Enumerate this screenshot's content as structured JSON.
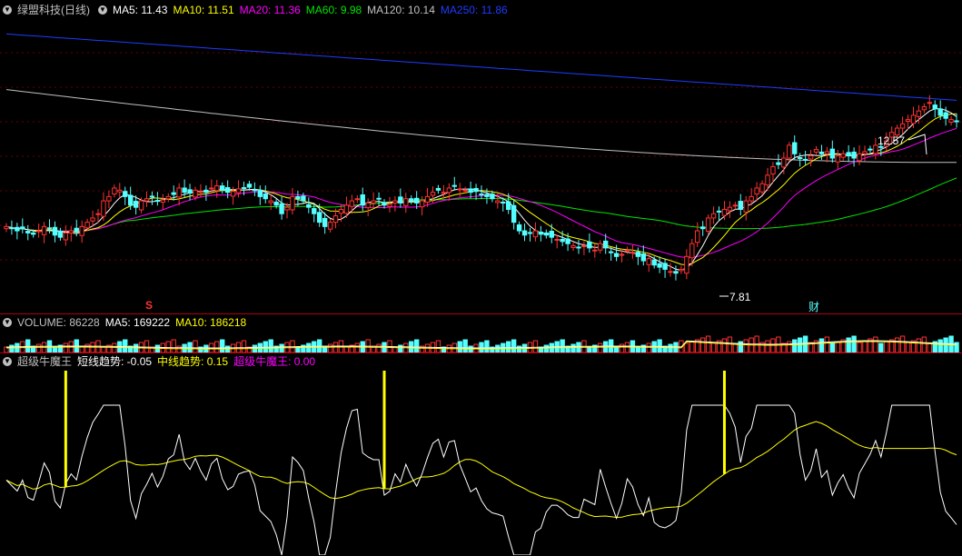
{
  "colors": {
    "red": "#ff3232",
    "cyan": "#54ffff",
    "white": "#ffffff",
    "yellow": "#ffff00",
    "magenta": "#ff00ff",
    "green": "#00e600",
    "gray": "#c0c0c0",
    "blue": "#1e3cff"
  },
  "main_legend": {
    "icon": "collapse-circle-icon",
    "title": "绿盟科技(日线)",
    "ma5": "MA5: 11.43",
    "ma10": "MA10: 11.51",
    "ma20": "MA20: 11.36",
    "ma60": "MA60: 9.98",
    "ma120": "MA120: 10.14",
    "ma250": "MA250: 11.86"
  },
  "volume_legend": {
    "icon": "collapse-circle-icon",
    "volume": "VOLUME: 86228",
    "ma5": "MA5: 169222",
    "ma10": "MA10: 186218"
  },
  "indicator_legend": {
    "icon": "collapse-circle-icon",
    "name": "超级牛魔王",
    "short_trend": "短线趋势: -0.05",
    "mid_trend": "中线趋势: 0.15",
    "niu": "超级牛魔王: 0.00"
  },
  "annotations": {
    "high_label": "12.57",
    "low_label": "7.81",
    "marker_s": "S",
    "marker_cai": "财"
  },
  "chart_data": [
    {
      "type": "candlestick",
      "title": "绿盟科技(日线)",
      "ylim": [
        7.4,
        13.6
      ],
      "x": [
        0,
        1,
        2,
        3,
        4,
        5,
        6,
        7,
        8,
        9,
        10,
        11,
        12,
        13,
        14,
        15,
        16,
        17,
        18,
        19,
        20,
        21,
        22,
        23,
        24,
        25,
        26,
        27,
        28,
        29,
        30,
        31,
        32,
        33,
        34,
        35,
        36,
        37,
        38,
        39,
        40,
        41,
        42,
        43,
        44,
        45,
        46,
        47,
        48,
        49,
        50,
        51,
        52,
        53,
        54,
        55,
        56,
        57,
        58,
        59,
        60,
        61,
        62,
        63,
        64,
        65,
        66,
        67,
        68,
        69,
        70,
        71,
        72,
        73,
        74,
        75,
        76,
        77,
        78,
        79,
        80,
        81,
        82,
        83,
        84,
        85,
        86,
        87,
        88,
        89,
        90,
        91,
        92,
        93,
        94,
        95,
        96,
        97,
        98,
        99,
        100,
        101,
        102,
        103,
        104,
        105,
        106,
        107,
        108,
        109,
        110,
        111,
        112,
        113,
        114,
        115,
        116,
        117,
        118,
        119,
        120,
        121,
        122,
        123,
        124,
        125,
        126,
        127,
        128,
        129,
        130,
        131,
        132,
        133,
        134,
        135,
        136,
        137,
        138,
        139,
        140,
        141,
        142,
        143,
        144,
        145,
        146,
        147,
        148,
        149,
        150,
        151,
        152,
        153,
        154,
        155,
        156,
        157,
        158,
        159,
        160,
        161,
        162,
        163,
        164,
        165,
        166,
        167,
        168,
        169,
        170,
        171,
        172,
        173,
        174,
        175
      ],
      "close": [
        8.9,
        8.85,
        8.8,
        8.85,
        8.75,
        8.72,
        8.8,
        8.9,
        8.85,
        8.7,
        8.65,
        8.75,
        8.8,
        8.78,
        8.9,
        9.0,
        9.1,
        9.2,
        9.5,
        9.6,
        9.8,
        9.75,
        9.6,
        9.4,
        9.35,
        9.5,
        9.55,
        9.6,
        9.5,
        9.52,
        9.6,
        9.65,
        9.8,
        9.7,
        9.68,
        9.75,
        9.72,
        9.7,
        9.8,
        9.85,
        9.75,
        9.7,
        9.72,
        9.78,
        9.8,
        9.82,
        9.75,
        9.6,
        9.55,
        9.5,
        9.4,
        9.2,
        9.35,
        9.6,
        9.55,
        9.5,
        9.35,
        9.2,
        9.0,
        8.9,
        9.0,
        9.15,
        9.3,
        9.4,
        9.5,
        9.55,
        9.4,
        9.45,
        9.5,
        9.55,
        9.4,
        9.42,
        9.5,
        9.45,
        9.55,
        9.5,
        9.45,
        9.5,
        9.6,
        9.7,
        9.75,
        9.7,
        9.8,
        9.85,
        9.78,
        9.75,
        9.7,
        9.72,
        9.65,
        9.6,
        9.55,
        9.5,
        9.45,
        9.3,
        9.0,
        8.8,
        8.7,
        8.75,
        8.8,
        8.72,
        8.7,
        8.65,
        8.6,
        8.55,
        8.5,
        8.45,
        8.4,
        8.45,
        8.4,
        8.35,
        8.5,
        8.4,
        8.3,
        8.2,
        8.25,
        8.35,
        8.3,
        8.2,
        8.1,
        8.15,
        8.0,
        7.95,
        7.9,
        7.85,
        7.81,
        7.9,
        8.2,
        8.5,
        8.8,
        8.85,
        9.1,
        9.2,
        9.25,
        9.3,
        9.35,
        9.4,
        9.3,
        9.5,
        9.6,
        9.8,
        9.9,
        10.1,
        10.3,
        10.35,
        10.5,
        10.8,
        10.6,
        10.5,
        10.45,
        10.55,
        10.7,
        10.6,
        10.65,
        10.5,
        10.55,
        10.6,
        10.55,
        10.5,
        10.6,
        10.65,
        10.7,
        10.8,
        10.75,
        10.9,
        11.1,
        11.2,
        11.3,
        11.4,
        11.5,
        11.6,
        11.7,
        11.8,
        11.65,
        11.5,
        11.43,
        11.4,
        11.35
      ],
      "label_high": 12.57,
      "label_low": 7.81
    },
    {
      "type": "bar",
      "title": "VOLUME",
      "series": [
        {
          "name": "VOLUME",
          "last": 86228
        },
        {
          "name": "MA5",
          "last": 169222
        },
        {
          "name": "MA10",
          "last": 186218
        }
      ]
    },
    {
      "type": "line",
      "title": "超级牛魔王",
      "ylim": [
        -0.6,
        0.6
      ],
      "series": [
        {
          "name": "短线趋势",
          "last": -0.05
        },
        {
          "name": "中线趋势",
          "last": 0.15
        },
        {
          "name": "超级牛魔王",
          "last": 0.0
        }
      ]
    }
  ]
}
